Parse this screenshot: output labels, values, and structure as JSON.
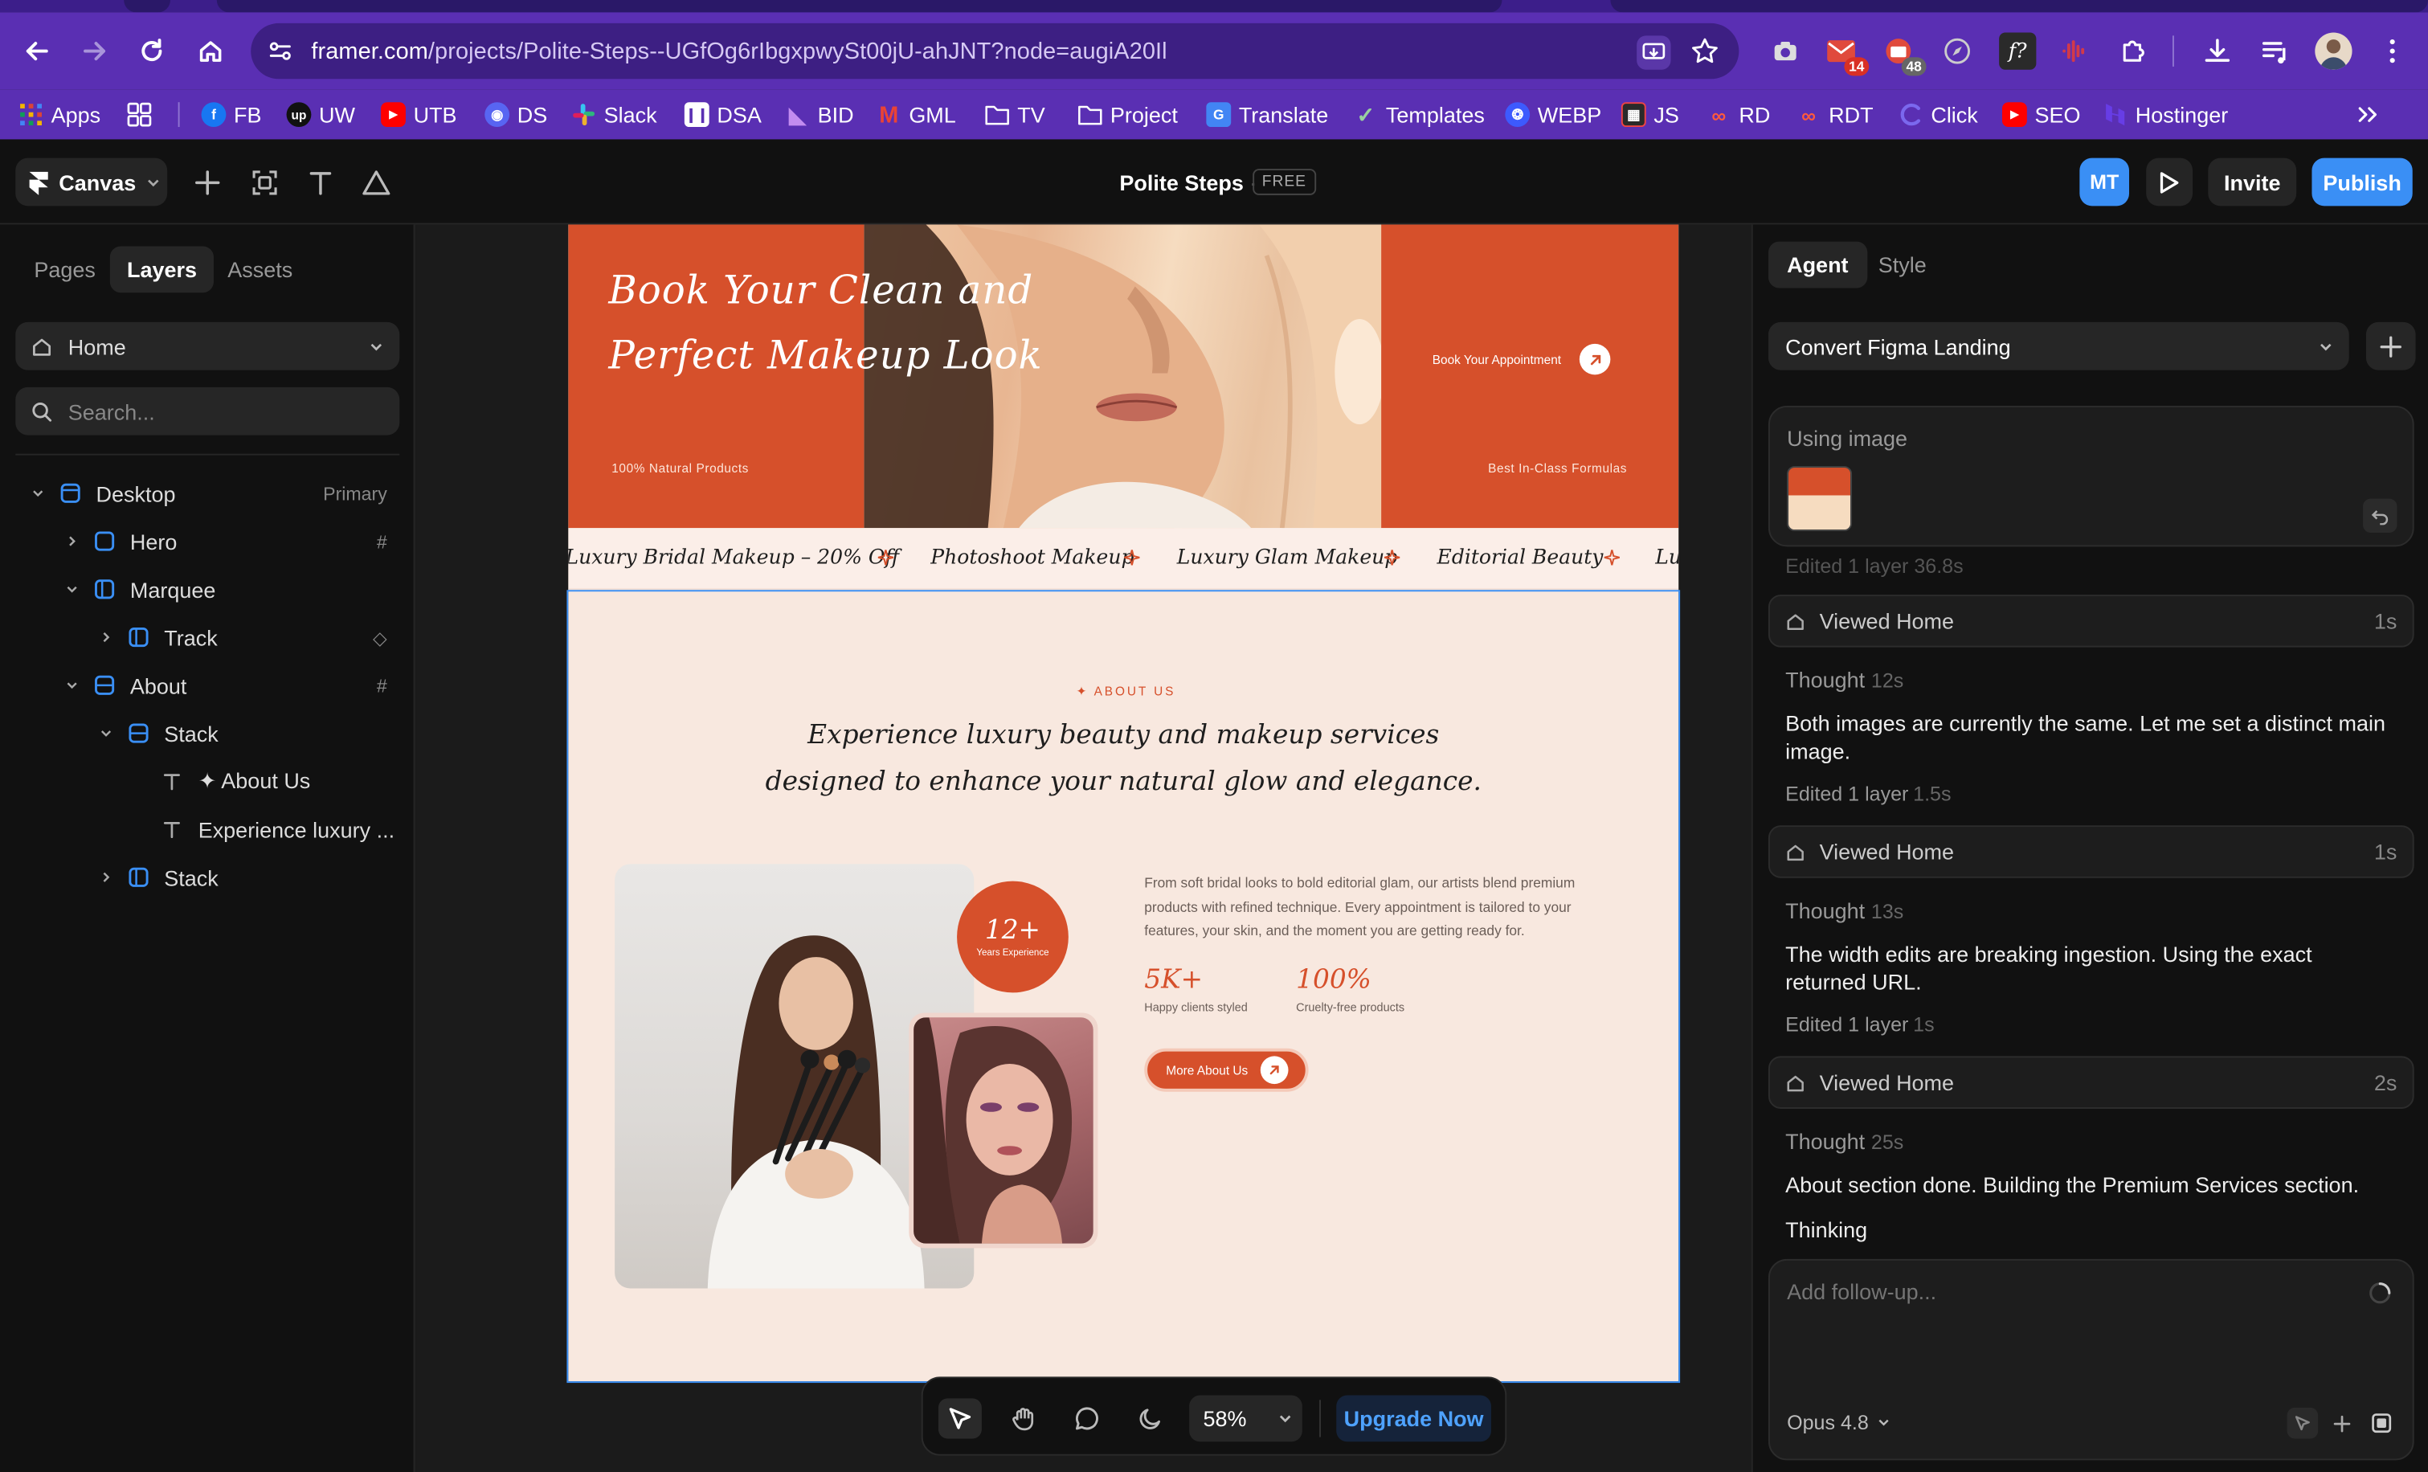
{
  "browser": {
    "url_host": "framer.com",
    "url_path": "/projects/Polite-Steps--UGfOg6rIbgxpwySt00jU-ahJNT?node=augiA20Il",
    "badges": {
      "mail": "14",
      "calendar": "48"
    },
    "bookmarks": [
      {
        "label": "Apps"
      },
      {
        "label": ""
      },
      {
        "label": "FB"
      },
      {
        "label": "UW"
      },
      {
        "label": "UTB"
      },
      {
        "label": "DS"
      },
      {
        "label": "Slack"
      },
      {
        "label": "DSA"
      },
      {
        "label": "BID"
      },
      {
        "label": "GML"
      },
      {
        "label": "TV"
      },
      {
        "label": "Project"
      },
      {
        "label": "Translate"
      },
      {
        "label": "Templates"
      },
      {
        "label": "WEBP"
      },
      {
        "label": "JS"
      },
      {
        "label": "RD"
      },
      {
        "label": "RDT"
      },
      {
        "label": "Click"
      },
      {
        "label": "SEO"
      },
      {
        "label": "Hostinger"
      }
    ]
  },
  "framer": {
    "canvas_menu": "Canvas",
    "project_title": "Polite Steps",
    "separator": "·",
    "plan_badge": "FREE",
    "avatar_initials": "MT",
    "invite_label": "Invite",
    "publish_label": "Publish"
  },
  "left_panel": {
    "tabs": [
      "Pages",
      "Layers",
      "Assets"
    ],
    "active_tab": "Layers",
    "page_select": "Home",
    "search_placeholder": "Search...",
    "layers": [
      {
        "label": "Desktop",
        "right": "Primary"
      },
      {
        "label": "Hero",
        "right": "#"
      },
      {
        "label": "Marquee",
        "right": ""
      },
      {
        "label": "Track",
        "right": "◇"
      },
      {
        "label": "About",
        "right": "#"
      },
      {
        "label": "Stack",
        "right": ""
      },
      {
        "label": "✦ About Us",
        "right": ""
      },
      {
        "label": "Experience luxury ...",
        "right": ""
      },
      {
        "label": "Stack",
        "right": ""
      }
    ]
  },
  "site": {
    "hero_title_line1": "Book Your Clean and",
    "hero_title_line2": "Perfect Makeup Look",
    "hero_sub_left": "100% Natural Products",
    "hero_cta": "Book Your Appointment",
    "hero_sub_right": "Best In-Class Formulas",
    "marquee": [
      "Luxury Bridal Makeup – 20% Off",
      "Photoshoot Makeup",
      "Luxury Glam Makeup",
      "Editorial Beauty",
      "Lu"
    ],
    "about_eyebrow": "✦ ABOUT US",
    "about_title_line1": "Experience luxury beauty and makeup services",
    "about_title_line2": "designed to enhance your natural glow and elegance.",
    "experience_value": "12+",
    "experience_label": "Years Experience",
    "about_body": "From soft bridal looks to bold editorial glam, our artists blend premium products with refined technique. Every appointment is tailored to your features, your skin, and the moment you are getting ready for.",
    "stats": [
      {
        "value": "5K+",
        "label": "Happy clients styled"
      },
      {
        "value": "100%",
        "label": "Cruelty-free products"
      }
    ],
    "more_button": "More About Us"
  },
  "bottom_bar": {
    "zoom": "58%",
    "upgrade": "Upgrade Now"
  },
  "right_panel": {
    "tabs": [
      "Agent",
      "Style"
    ],
    "active_tab": "Agent",
    "agent_select": "Convert Figma Landing",
    "using_image": "Using image",
    "cut_text": "Edited 1 layer 36.8s",
    "timeline": [
      {
        "tool": "Viewed Home",
        "duration": "1s"
      },
      {
        "thought_label": "Thought",
        "thought_time": "12s",
        "message": "Both images are currently the same. Let me set a distinct main image.",
        "edited": "Edited 1 layer",
        "edited_time": "1.5s"
      },
      {
        "tool": "Viewed Home",
        "duration": "1s"
      },
      {
        "thought_label": "Thought",
        "thought_time": "13s",
        "message": "The width edits are breaking ingestion. Using the exact returned URL.",
        "edited": "Edited 1 layer",
        "edited_time": "1s"
      },
      {
        "tool": "Viewed Home",
        "duration": "2s"
      },
      {
        "thought_label": "Thought",
        "thought_time": "25s",
        "message": "About section done. Building the Premium Services section."
      }
    ],
    "thinking": "Thinking",
    "followup_placeholder": "Add follow-up...",
    "model": "Opus 4.8"
  },
  "colors": {
    "browser_purple": "#5a2fb3",
    "framer_blue": "#3a8ff5",
    "brand_orange": "#d6502b",
    "cream": "#f8e8df"
  }
}
